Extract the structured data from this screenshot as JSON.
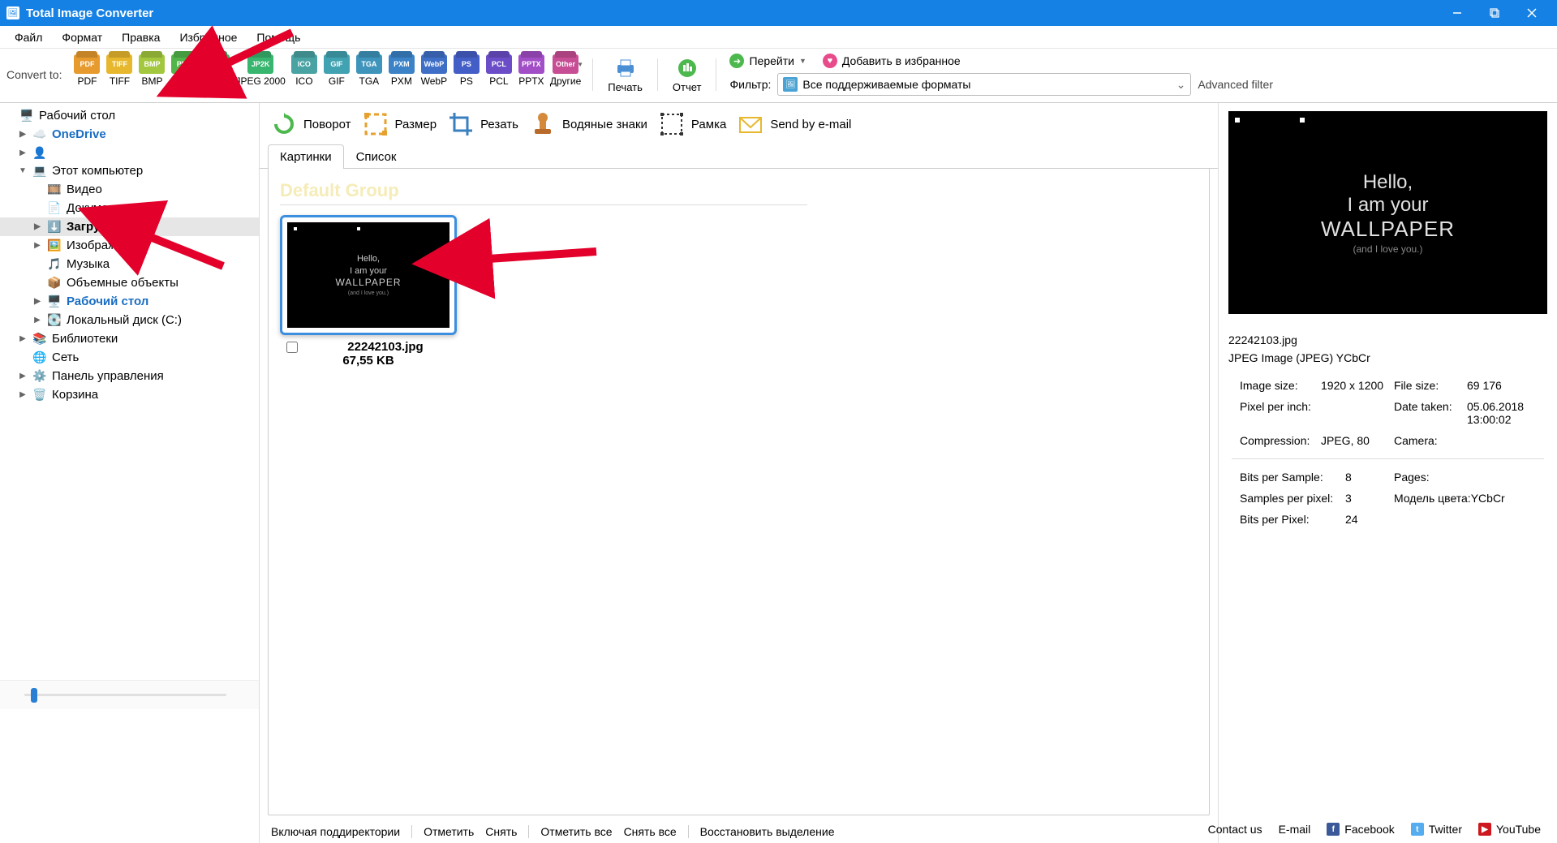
{
  "window": {
    "title": "Total Image Converter"
  },
  "menu": [
    "Файл",
    "Формат",
    "Правка",
    "Избранное",
    "Помощь"
  ],
  "toolbar": {
    "convert_label": "Convert to:",
    "formats": [
      {
        "label": "PDF",
        "tag": "PDF",
        "cls": "c-pdf"
      },
      {
        "label": "TIFF",
        "tag": "TIFF",
        "cls": "c-tiff"
      },
      {
        "label": "BMP",
        "tag": "BMP",
        "cls": "c-bmp"
      },
      {
        "label": "PNG",
        "tag": "PNG",
        "cls": "c-png"
      },
      {
        "label": "JPEG",
        "tag": "JPEG",
        "cls": "c-jpeg"
      },
      {
        "label": "JPEG 2000",
        "tag": "JP2K",
        "cls": "c-jp2k"
      },
      {
        "label": "ICO",
        "tag": "ICO",
        "cls": "c-ico"
      },
      {
        "label": "GIF",
        "tag": "GIF",
        "cls": "c-gif"
      },
      {
        "label": "TGA",
        "tag": "TGA",
        "cls": "c-tga"
      },
      {
        "label": "PXM",
        "tag": "PXM",
        "cls": "c-pxm"
      },
      {
        "label": "WebP",
        "tag": "WebP",
        "cls": "c-webp"
      },
      {
        "label": "PS",
        "tag": "PS",
        "cls": "c-ps"
      },
      {
        "label": "PCL",
        "tag": "PCL",
        "cls": "c-pcl"
      },
      {
        "label": "PPTX",
        "tag": "PPTX",
        "cls": "c-pptx"
      },
      {
        "label": "Другие",
        "tag": "Other",
        "cls": "c-other"
      }
    ],
    "print": "Печать",
    "report": "Отчет",
    "go": "Перейти",
    "favorite": "Добавить в избранное",
    "filter_label": "Фильтр:",
    "filter_value": "Все поддерживаемые форматы",
    "adv_filter": "Advanced filter"
  },
  "sidebar": [
    {
      "label": "Рабочий стол",
      "depth": 0,
      "icon": "desktop",
      "arrow": "",
      "blue": false
    },
    {
      "label": "OneDrive",
      "depth": 1,
      "icon": "cloud",
      "arrow": "▶",
      "blue": true
    },
    {
      "label": "",
      "depth": 1,
      "icon": "user",
      "arrow": "▶",
      "blue": false
    },
    {
      "label": "Этот компьютер",
      "depth": 1,
      "icon": "pc",
      "arrow": "▼",
      "blue": false
    },
    {
      "label": "Видео",
      "depth": 2,
      "icon": "video",
      "arrow": "",
      "blue": false
    },
    {
      "label": "Документы",
      "depth": 2,
      "icon": "doc",
      "arrow": "",
      "blue": false
    },
    {
      "label": "Загрузки",
      "depth": 2,
      "icon": "down",
      "arrow": "▶",
      "blue": false,
      "selected": true,
      "bold": true
    },
    {
      "label": "Изображения",
      "depth": 2,
      "icon": "img",
      "arrow": "▶",
      "blue": false
    },
    {
      "label": "Музыка",
      "depth": 2,
      "icon": "music",
      "arrow": "",
      "blue": false
    },
    {
      "label": "Объемные объекты",
      "depth": 2,
      "icon": "cube",
      "arrow": "",
      "blue": false
    },
    {
      "label": "Рабочий стол",
      "depth": 2,
      "icon": "desktop",
      "arrow": "▶",
      "blue": true,
      "bold": true
    },
    {
      "label": "Локальный диск (C:)",
      "depth": 2,
      "icon": "disk",
      "arrow": "▶",
      "blue": false
    },
    {
      "label": "Библиотеки",
      "depth": 1,
      "icon": "lib",
      "arrow": "▶",
      "blue": false
    },
    {
      "label": "Сеть",
      "depth": 1,
      "icon": "net",
      "arrow": "",
      "blue": false
    },
    {
      "label": "Панель управления",
      "depth": 1,
      "icon": "ctrl",
      "arrow": "▶",
      "blue": false
    },
    {
      "label": "Корзина",
      "depth": 1,
      "icon": "trash",
      "arrow": "▶",
      "blue": false
    }
  ],
  "ops": {
    "rotate": "Поворот",
    "resize": "Размер",
    "crop": "Резать",
    "watermark": "Водяные знаки",
    "frame": "Рамка",
    "email": "Send by e-mail"
  },
  "tabs": {
    "pictures": "Картинки",
    "list": "Список"
  },
  "group_title": "Default Group",
  "thumb": {
    "filename": "22242103.jpg",
    "size": "67,55 KB",
    "lines": [
      "Hello,",
      "I am your",
      "WALLPAPER",
      "(and I love you.)"
    ]
  },
  "bottom": [
    "Включая поддиректории",
    "Отметить",
    "Снять",
    "Отметить все",
    "Снять все",
    "Восстановить выделение"
  ],
  "preview": {
    "filename": "22242103.jpg",
    "type": "JPEG Image (JPEG) YCbCr",
    "lines": [
      "Hello,",
      "I am your",
      "WALLPAPER",
      "(and I love you.)"
    ],
    "grid": {
      "imgsize_l": "Image size:",
      "imgsize_v": "1920 x 1200",
      "filesize_l": "File size:",
      "filesize_v": "69 176",
      "ppi_l": "Pixel per inch:",
      "ppi_v": "",
      "date_l": "Date taken:",
      "date_v": "05.06.2018 13:00:02",
      "comp_l": "Compression:",
      "comp_v": "JPEG, 80",
      "cam_l": "Camera:",
      "cam_v": ""
    },
    "grid2": {
      "bps_l": "Bits per Sample:",
      "bps_v": "8",
      "pages_l": "Pages:",
      "pages_v": "",
      "spp_l": "Samples per pixel:",
      "spp_v": "3",
      "model_l": "Модель цвета:",
      "model_v": "YCbCr",
      "bpp_l": "Bits per Pixel:",
      "bpp_v": "24"
    }
  },
  "footer": {
    "contact": "Contact us",
    "email": "E-mail",
    "fb": "Facebook",
    "tw": "Twitter",
    "yt": "YouTube"
  }
}
